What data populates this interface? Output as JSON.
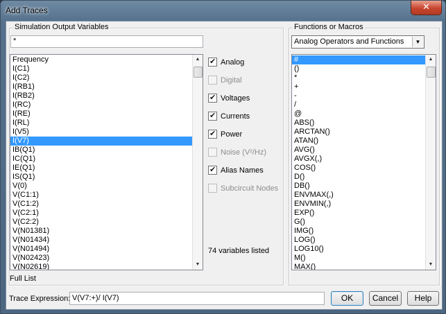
{
  "window": {
    "title": "Add Traces",
    "close_glyph": "✕"
  },
  "sim_group": {
    "legend": "Simulation Output Variables",
    "filter_value": "*",
    "items": [
      "Frequency",
      "I(C1)",
      "I(C2)",
      "I(RB1)",
      "I(RB2)",
      "I(RC)",
      "I(RE)",
      "I(RL)",
      "I(V5)",
      "I(V7)",
      "IB(Q1)",
      "IC(Q1)",
      "IE(Q1)",
      "IS(Q1)",
      "V(0)",
      "V(C1:1)",
      "V(C1:2)",
      "V(C2:1)",
      "V(C2:2)",
      "V(N01381)",
      "V(N01434)",
      "V(N01494)",
      "V(N02423)",
      "V(N02619)"
    ],
    "selected_item": "I(V7)",
    "footer": "Full List"
  },
  "options": [
    {
      "label": "Analog",
      "checked": true,
      "enabled": true
    },
    {
      "label": "Digital",
      "checked": false,
      "enabled": false
    },
    {
      "label": "Voltages",
      "checked": true,
      "enabled": true
    },
    {
      "label": "Currents",
      "checked": true,
      "enabled": true
    },
    {
      "label": "Power",
      "checked": true,
      "enabled": true
    },
    {
      "label": "Noise (V²/Hz)",
      "checked": false,
      "enabled": false
    },
    {
      "label": "Alias Names",
      "checked": true,
      "enabled": true
    },
    {
      "label": "Subcircuit Nodes",
      "checked": false,
      "enabled": false
    }
  ],
  "variables_count_text": "74 variables listed",
  "func_group": {
    "legend": "Functions or Macros",
    "dropdown_value": "Analog Operators and Functions",
    "items": [
      "#",
      "()",
      "*",
      "+",
      "-",
      "/",
      "@",
      "ABS()",
      "ARCTAN()",
      "ATAN()",
      "AVG()",
      "AVGX(,)",
      "COS()",
      "D()",
      "DB()",
      "ENVMAX(,)",
      "ENVMIN(,)",
      "EXP()",
      "G()",
      "IMG()",
      "LOG()",
      "LOG10()",
      "M()",
      "MAX()"
    ],
    "selected_item": "#"
  },
  "trace": {
    "label": "Trace Expression:",
    "value": "V(V7:+)/ I(V7)"
  },
  "buttons": {
    "ok": "OK",
    "cancel": "Cancel",
    "help": "Help"
  }
}
